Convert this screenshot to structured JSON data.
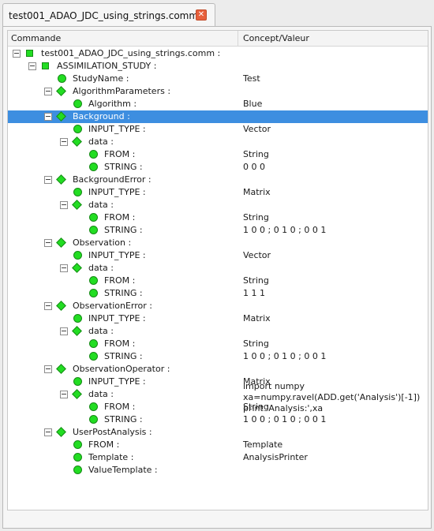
{
  "tab": {
    "title": "test001_ADAO_JDC_using_strings.comm",
    "close_glyph": "✕"
  },
  "header": {
    "col_command": "Commande",
    "col_value": "Concept/Valeur"
  },
  "colors": {
    "node_green": "#22dd22",
    "selection": "#3d8ee0",
    "close": "#e8603c"
  },
  "tree": [
    {
      "label": "test001_ADAO_JDC_using_strings.comm :",
      "value": "",
      "icon": "square-icon",
      "level": 0,
      "expander": true
    },
    {
      "label": "ASSIMILATION_STUDY :",
      "value": "",
      "icon": "square-icon",
      "level": 1,
      "expander": true
    },
    {
      "label": "StudyName :",
      "value": "Test",
      "icon": "circle-icon",
      "level": 2,
      "expander": false
    },
    {
      "label": "AlgorithmParameters :",
      "value": "",
      "icon": "diamond-icon",
      "level": 2,
      "expander": true
    },
    {
      "label": "Algorithm :",
      "value": "Blue",
      "icon": "circle-icon",
      "level": 3,
      "expander": false
    },
    {
      "label": "Background :",
      "value": "",
      "icon": "diamond-icon",
      "level": 2,
      "expander": true,
      "selected": true
    },
    {
      "label": "INPUT_TYPE :",
      "value": "Vector",
      "icon": "circle-icon",
      "level": 3,
      "expander": false
    },
    {
      "label": "data :",
      "value": "",
      "icon": "diamond-icon",
      "level": 3,
      "expander": true
    },
    {
      "label": "FROM :",
      "value": "String",
      "icon": "circle-icon",
      "level": 4,
      "expander": false
    },
    {
      "label": "STRING :",
      "value": "0 0 0",
      "icon": "circle-icon",
      "level": 4,
      "expander": false
    },
    {
      "label": "BackgroundError :",
      "value": "",
      "icon": "diamond-icon",
      "level": 2,
      "expander": true
    },
    {
      "label": "INPUT_TYPE :",
      "value": "Matrix",
      "icon": "circle-icon",
      "level": 3,
      "expander": false
    },
    {
      "label": "data :",
      "value": "",
      "icon": "diamond-icon",
      "level": 3,
      "expander": true
    },
    {
      "label": "FROM :",
      "value": "String",
      "icon": "circle-icon",
      "level": 4,
      "expander": false
    },
    {
      "label": "STRING :",
      "value": "1 0 0 ; 0 1 0 ; 0 0 1",
      "icon": "circle-icon",
      "level": 4,
      "expander": false
    },
    {
      "label": "Observation :",
      "value": "",
      "icon": "diamond-icon",
      "level": 2,
      "expander": true
    },
    {
      "label": "INPUT_TYPE :",
      "value": "Vector",
      "icon": "circle-icon",
      "level": 3,
      "expander": false
    },
    {
      "label": "data :",
      "value": "",
      "icon": "diamond-icon",
      "level": 3,
      "expander": true
    },
    {
      "label": "FROM :",
      "value": "String",
      "icon": "circle-icon",
      "level": 4,
      "expander": false
    },
    {
      "label": "STRING :",
      "value": "1 1 1",
      "icon": "circle-icon",
      "level": 4,
      "expander": false
    },
    {
      "label": "ObservationError :",
      "value": "",
      "icon": "diamond-icon",
      "level": 2,
      "expander": true
    },
    {
      "label": "INPUT_TYPE :",
      "value": "Matrix",
      "icon": "circle-icon",
      "level": 3,
      "expander": false
    },
    {
      "label": "data :",
      "value": "",
      "icon": "diamond-icon",
      "level": 3,
      "expander": true
    },
    {
      "label": "FROM :",
      "value": "String",
      "icon": "circle-icon",
      "level": 4,
      "expander": false
    },
    {
      "label": "STRING :",
      "value": "1 0 0 ; 0 1 0 ; 0 0 1",
      "icon": "circle-icon",
      "level": 4,
      "expander": false
    },
    {
      "label": "ObservationOperator :",
      "value": "",
      "icon": "diamond-icon",
      "level": 2,
      "expander": true
    },
    {
      "label": "INPUT_TYPE :",
      "value": "Matrix",
      "icon": "circle-icon",
      "level": 3,
      "expander": false
    },
    {
      "label": "data :",
      "value": "",
      "icon": "diamond-icon",
      "level": 3,
      "expander": true
    },
    {
      "label": "FROM :",
      "value": "String",
      "icon": "circle-icon",
      "level": 4,
      "expander": false
    },
    {
      "label": "STRING :",
      "value": "1 0 0 ; 0 1 0 ; 0 0 1",
      "icon": "circle-icon",
      "level": 4,
      "expander": false
    },
    {
      "label": "UserPostAnalysis :",
      "value": "",
      "icon": "diamond-icon",
      "level": 2,
      "expander": true
    },
    {
      "label": "FROM :",
      "value": "Template",
      "icon": "circle-icon",
      "level": 3,
      "expander": false
    },
    {
      "label": "Template :",
      "value": "AnalysisPrinter",
      "icon": "circle-icon",
      "level": 3,
      "expander": false
    },
    {
      "label": "ValueTemplate :",
      "value": "",
      "icon": "circle-icon",
      "level": 3,
      "expander": false
    }
  ],
  "value_template_text": "import numpy\nxa=numpy.ravel(ADD.get('Analysis')[-1])\nprint 'Analysis:',xa"
}
